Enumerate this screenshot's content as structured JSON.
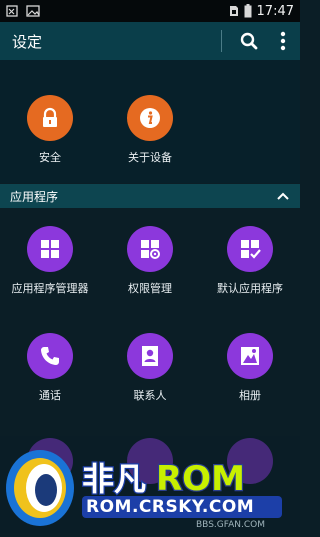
{
  "status_bar": {
    "time": "17:47",
    "icons": [
      "usb-icon",
      "image-icon",
      "sim-icon",
      "battery-icon"
    ]
  },
  "app_bar": {
    "title": "设定",
    "search_icon": "search-icon",
    "menu_icon": "more-vert-icon"
  },
  "top_section": {
    "items": [
      {
        "label": "安全",
        "icon": "lock-icon",
        "color": "#e56a21"
      },
      {
        "label": "关于设备",
        "icon": "info-icon",
        "color": "#e56a21"
      }
    ]
  },
  "apps_section": {
    "header": "应用程序",
    "collapse_icon": "chevron-up-icon",
    "items": [
      {
        "label": "应用程序管理器",
        "icon": "app-grid-icon",
        "color": "#8c38dc"
      },
      {
        "label": "权限管理",
        "icon": "app-grid-gear-icon",
        "color": "#8c38dc"
      },
      {
        "label": "默认应用程序",
        "icon": "app-grid-check-icon",
        "color": "#8c38dc"
      },
      {
        "label": "通话",
        "icon": "phone-icon",
        "color": "#8c38dc"
      },
      {
        "label": "联系人",
        "icon": "contact-icon",
        "color": "#8c38dc"
      },
      {
        "label": "相册",
        "icon": "gallery-icon",
        "color": "#8c38dc"
      }
    ]
  },
  "watermark": {
    "logo_text": "非凡ROM",
    "url": "ROM.CRSKY.COM",
    "sub_url": "BBS.GFAN.COM"
  }
}
